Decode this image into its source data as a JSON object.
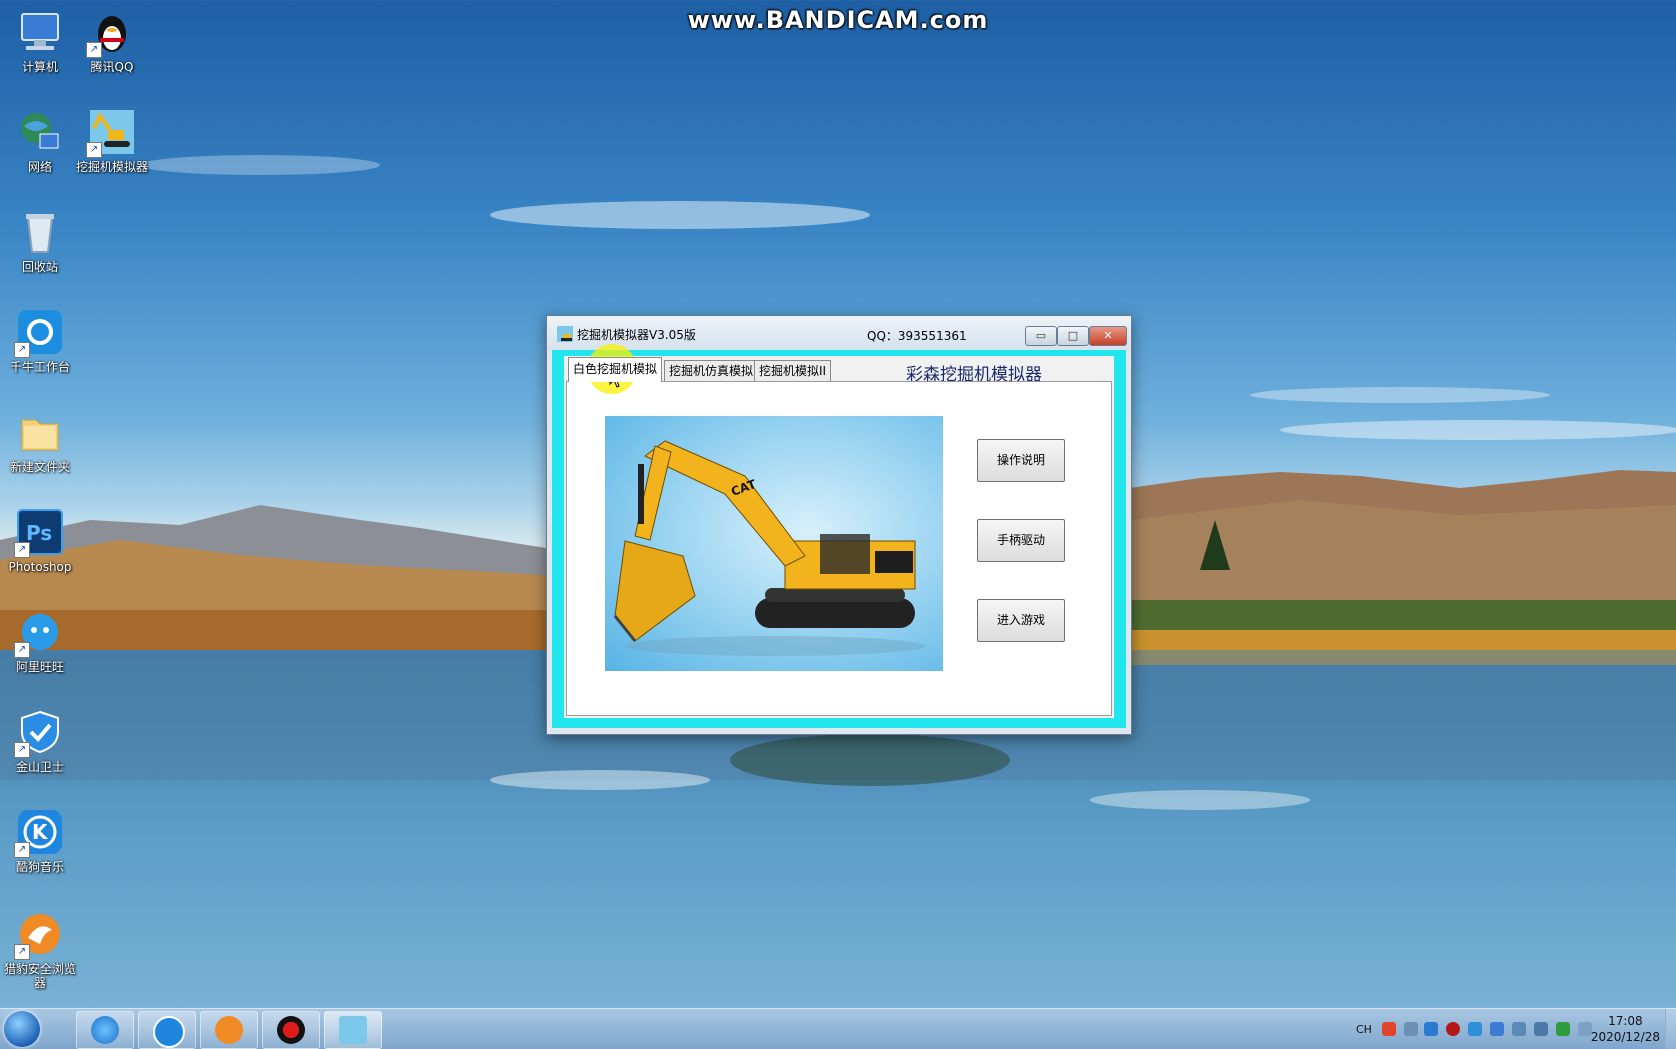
{
  "watermark": "www.BANDICAM.com",
  "desktop_icons": [
    {
      "label": "计算机"
    },
    {
      "label": "腾讯QQ"
    },
    {
      "label": "网络"
    },
    {
      "label": "挖掘机模拟器"
    },
    {
      "label": "回收站"
    },
    {
      "label": "千牛工作台"
    },
    {
      "label": "新建文件夹"
    },
    {
      "label": "Photoshop"
    },
    {
      "label": "阿里旺旺"
    },
    {
      "label": "金山卫士"
    },
    {
      "label": "酷狗音乐"
    },
    {
      "label": "猎豹安全浏览器"
    }
  ],
  "window": {
    "title": "挖掘机模拟器V3.05版",
    "qq_label": "QQ：393551361",
    "controls": {
      "minimize": "▭",
      "maximize": "□",
      "close": "✕"
    },
    "tabs": [
      {
        "label": "白色挖掘机模拟",
        "active": true
      },
      {
        "label": "挖掘机仿真模拟",
        "active": false
      },
      {
        "label": "挖掘机模拟II",
        "active": false
      }
    ],
    "headline": "彩森挖掘机模拟器",
    "picture_badge": "CAT",
    "buttons": {
      "help": "操作说明",
      "gamepad": "手柄驱动",
      "play": "进入游戏"
    }
  },
  "taskbar": {
    "tray_lang": "CH",
    "clock_time": "17:08",
    "clock_date": "2020/12/28"
  },
  "colors": {
    "window_frame_accent": "#21e6ee",
    "taskbar": "#8fb3d6",
    "headline_text": "#1a2a6e"
  }
}
